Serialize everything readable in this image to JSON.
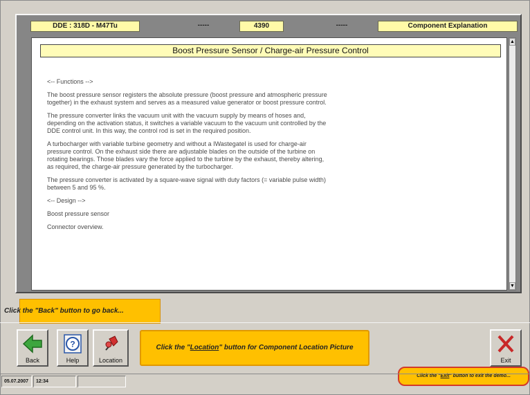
{
  "header": {
    "module": "DDE : 318D - M47Tu",
    "sep1": "-----",
    "code": "4390",
    "sep2": "-----",
    "section": "Component Explanation"
  },
  "content": {
    "title": "Boost Pressure Sensor / Charge-air Pressure Control",
    "functions_heading": "<-- Functions -->",
    "para1": "The boost pressure sensor registers the absolute pressure (boost pressure and atmospheric pressure together) in the exhaust system and serves as a measured value generator or boost pressure control.",
    "para2": "The pressure converter links the vacuum unit with the vacuum supply by means of hoses and, depending on the activation status, it switches a variable vacuum to the vacuum unit controlled by the DDE control unit. In this way, the control rod is set in the required position.",
    "para3": "A turbocharger with variable turbine geometry and without a IWastegateI is used for charge-air pressure control. On the exhaust side there are adjustable blades on the outside of the turbine on rotating bearings. Those blades vary the force applied to the turbine by the exhaust, thereby altering, as required, the charge-air pressure generated by the turbocharger.",
    "para4": "The pressure converter is activated by a square-wave signal with duty factors (= variable pulse width) between 5 and 95 %.",
    "design_heading": "<-- Design -->",
    "item1": "Boost pressure sensor",
    "item2": "Connector overview."
  },
  "hints": {
    "back": "Click the \"Back\" button to go back...",
    "location_pre": "Click the \"",
    "location_link": "Location",
    "location_post": "\" button for Component Location Picture",
    "exit_pre": "Click the \"",
    "exit_link": "Exit",
    "exit_post": "\" button to exit the demo..."
  },
  "toolbar": {
    "back_label": "Back",
    "help_label": "Help",
    "location_label": "Location",
    "exit_label": "Exit"
  },
  "status": {
    "date": "05.07.2007",
    "time": "12:34",
    "extra": ""
  },
  "icons": {
    "back": "arrow-left-icon",
    "help": "question-circle-icon",
    "location": "pushpin-icon",
    "exit": "x-close-icon"
  },
  "colors": {
    "highlight_yellow": "#fffaa8",
    "hint_orange": "#ffc000",
    "exit_red": "#c82828",
    "back_green": "#3ea63e",
    "help_blue": "#2a56a8"
  }
}
